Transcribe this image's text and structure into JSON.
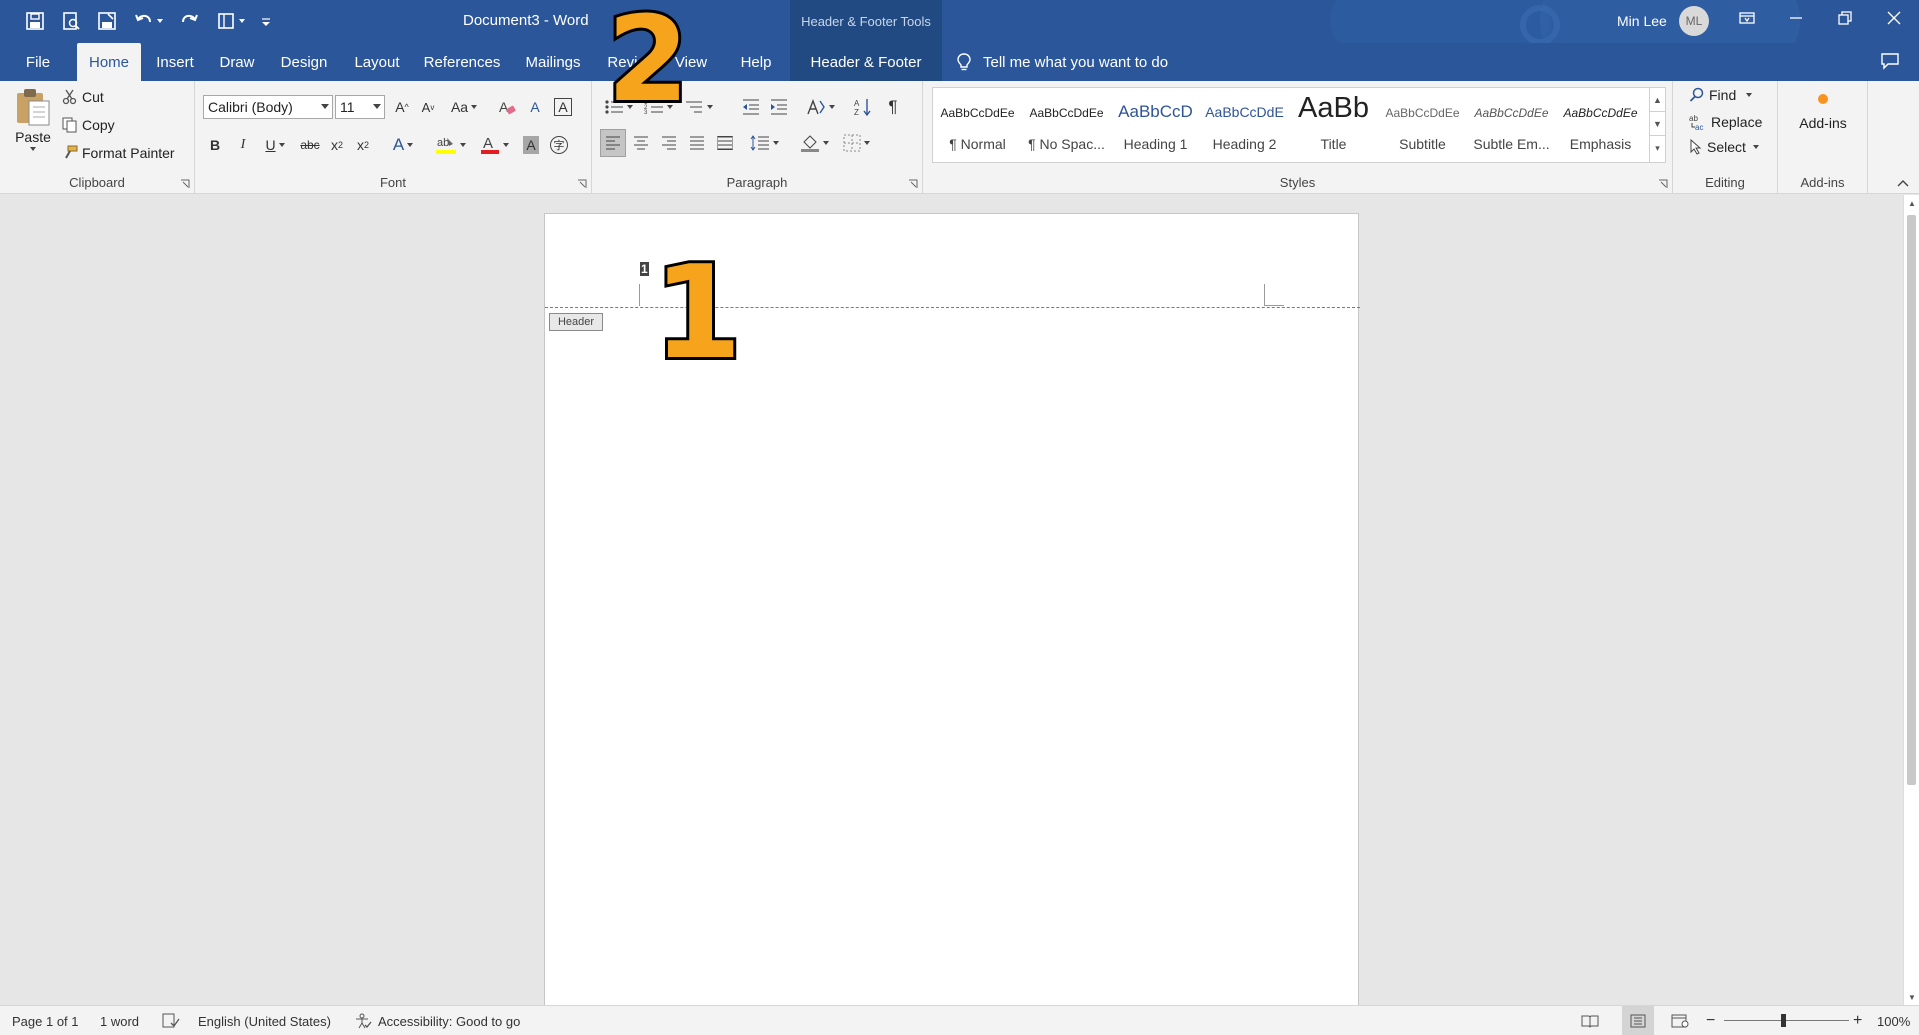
{
  "titlebar": {
    "doc_title": "Document3  -  Word",
    "context_title": "Header & Footer Tools",
    "user_name": "Min Lee",
    "user_initials": "ML",
    "qat_icons": [
      "save-icon",
      "print-preview-icon",
      "save-as-icon",
      "undo-icon",
      "redo-icon",
      "layout-icon",
      "customize-icon"
    ]
  },
  "tabs": [
    {
      "label": "File"
    },
    {
      "label": "Home"
    },
    {
      "label": "Insert"
    },
    {
      "label": "Draw"
    },
    {
      "label": "Design"
    },
    {
      "label": "Layout"
    },
    {
      "label": "References"
    },
    {
      "label": "Mailings"
    },
    {
      "label": "Review"
    },
    {
      "label": "View"
    },
    {
      "label": "Help"
    },
    {
      "label": "Header & Footer"
    }
  ],
  "tellme": "Tell me what you want to do",
  "clipboard": {
    "paste": "Paste",
    "cut": "Cut",
    "copy": "Copy",
    "format_painter": "Format Painter",
    "label": "Clipboard"
  },
  "font": {
    "family": "Calibri (Body)",
    "size": "11",
    "label": "Font"
  },
  "paragraph": {
    "label": "Paragraph"
  },
  "styles": {
    "label": "Styles",
    "items": [
      {
        "preview": "AaBbCcDdEe",
        "name": "¶ Normal"
      },
      {
        "preview": "AaBbCcDdEe",
        "name": "¶ No Spac..."
      },
      {
        "preview": "AaBbCcD",
        "name": "Heading 1"
      },
      {
        "preview": "AaBbCcDdE",
        "name": "Heading 2"
      },
      {
        "preview": "AaBb",
        "name": "Title"
      },
      {
        "preview": "AaBbCcDdEe",
        "name": "Subtitle"
      },
      {
        "preview": "AaBbCcDdEe",
        "name": "Subtle Em..."
      },
      {
        "preview": "AaBbCcDdEe",
        "name": "Emphasis"
      }
    ]
  },
  "editing": {
    "find": "Find",
    "replace": "Replace",
    "select": "Select",
    "label": "Editing"
  },
  "addins": {
    "button": "Add-ins",
    "label": "Add-ins"
  },
  "document": {
    "header_tag": "Header",
    "page_number": "1"
  },
  "annotations": {
    "one": "1",
    "two": "2"
  },
  "status": {
    "page": "Page 1 of 1",
    "words": "1 word",
    "language": "English (United States)",
    "accessibility": "Accessibility: Good to go",
    "zoom": "100%"
  },
  "colors": {
    "brand": "#2b579a",
    "context": "#214a82",
    "ribbon": "#f3f3f3",
    "annotation_fill": "#f7a41d"
  }
}
